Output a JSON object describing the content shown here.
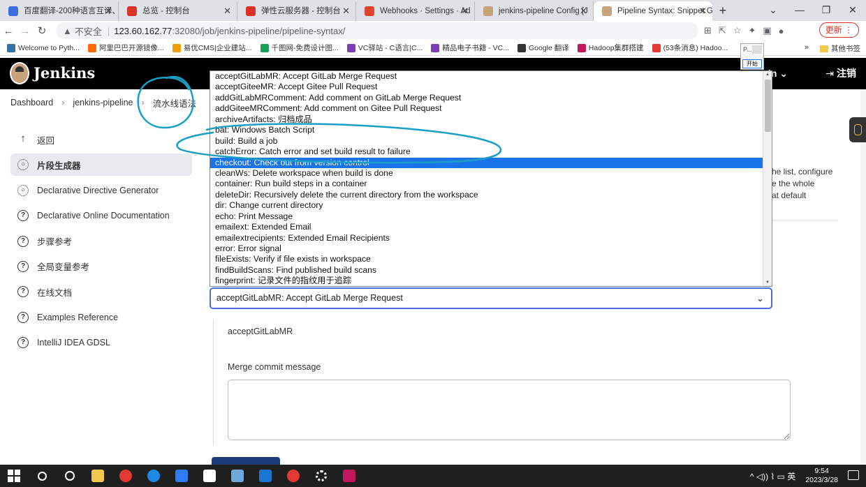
{
  "browser": {
    "tabs": [
      {
        "title": "百度翻译-200种语言互译、",
        "color": "#3b6fe0"
      },
      {
        "title": "总览 - 控制台",
        "color": "#e0302a"
      },
      {
        "title": "弹性云服务器 - 控制台",
        "color": "#e0302a"
      },
      {
        "title": "Webhooks · Settings · Ad",
        "color": "#e2432a"
      },
      {
        "title": "jenkins-pipeline Config [J",
        "color": "#c8a27a"
      },
      {
        "title": "Pipeline Syntax: Snippet G",
        "color": "#c8a27a",
        "active": true
      }
    ],
    "new_tab": "+",
    "window_controls": [
      "⌄",
      "—",
      "❐",
      "✕"
    ],
    "address": {
      "insecure_label": "不安全",
      "host": "123.60.162.77",
      "path": ":32080/job/jenkins-pipeline/pipeline-syntax/"
    },
    "update_button": "更新 ⋮",
    "bookmarks": [
      {
        "label": "Welcome to Pyth...",
        "color": "#3572a5"
      },
      {
        "label": "阿里巴巴开源镜像...",
        "color": "#ff6a00"
      },
      {
        "label": "易优CMS|企业建站...",
        "color": "#f29d0c"
      },
      {
        "label": "千图网-免费设计图...",
        "color": "#19a05a"
      },
      {
        "label": "VC驿站 - C语言|C...",
        "color": "#7a3fb5"
      },
      {
        "label": "精品电子书籍 - VC...",
        "color": "#7a3fb5"
      },
      {
        "label": "Google 翻译",
        "color": "#333333"
      },
      {
        "label": "Hadoop集群搭建",
        "color": "#c2185b"
      },
      {
        "label": "(53条消息) Hadoo...",
        "color": "#e53935"
      }
    ],
    "bookmarks_more": "»",
    "bookmarks_other": "其他书签",
    "mini_popup": {
      "text": "P...",
      "button": "开始"
    }
  },
  "jenkins": {
    "title": "Jenkins",
    "user": "min ⌄",
    "logout": "注销",
    "breadcrumb": [
      "Dashboard",
      "jenkins-pipeline",
      "流水线语法"
    ],
    "sidebar": [
      {
        "label": "返回",
        "icon": "arrow-up-icon"
      },
      {
        "label": "片段生成器",
        "icon": "gear-icon",
        "active": true
      },
      {
        "label": "Declarative Directive Generator",
        "icon": "gear-icon"
      },
      {
        "label": "Declarative Online Documentation",
        "icon": "help-icon"
      },
      {
        "label": "步骤参考",
        "icon": "help-icon"
      },
      {
        "label": "全局变量参考",
        "icon": "help-icon"
      },
      {
        "label": "在线文档",
        "icon": "help-icon"
      },
      {
        "label": "Examples Reference",
        "icon": "help-icon"
      },
      {
        "label": "IntelliJ IDEA GDSL",
        "icon": "help-icon"
      }
    ],
    "desc_fragments": [
      "he list, configure",
      "e the whole",
      "at default"
    ],
    "dropdown": [
      "acceptGitLabMR: Accept GitLab Merge Request",
      "acceptGiteeMR: Accept Gitee Pull Request",
      "addGitLabMRComment: Add comment on GitLab Merge Request",
      "addGiteeMRComment: Add comment on Gitee Pull Request",
      "archiveArtifacts: 归档成品",
      "bat: Windows Batch Script",
      "build: Build a job",
      "catchError: Catch error and set build result to failure",
      "checkout: Check out from version control",
      "cleanWs: Delete workspace when build is done",
      "container: Run build steps in a container",
      "deleteDir: Recursively delete the current directory from the workspace",
      "dir: Change current directory",
      "echo: Print Message",
      "emailext: Extended Email",
      "emailextrecipients: Extended Email Recipients",
      "error: Error signal",
      "fileExists: Verify if file exists in workspace",
      "findBuildScans: Find published build scans",
      "fingerprint: 记录文件的指纹用于追踪"
    ],
    "dropdown_selected_index": 8,
    "select_value": "acceptGitLabMR: Accept GitLab Merge Request",
    "step_name": "acceptGitLabMR",
    "field_label": "Merge commit message",
    "field_value": ""
  },
  "taskbar": {
    "apps": [
      {
        "name": "search-icon",
        "color": "#1f1f1f"
      },
      {
        "name": "task-view-icon",
        "color": "#1f1f1f"
      },
      {
        "name": "file-explorer-icon",
        "color": "#f2c94c"
      },
      {
        "name": "chrome-icon",
        "color": "#e53935"
      },
      {
        "name": "edge-icon",
        "color": "#1e88e5"
      },
      {
        "name": "feishu-icon",
        "color": "#2f7cf6"
      },
      {
        "name": "typora-icon",
        "color": "#ffffff"
      },
      {
        "name": "notepad-icon",
        "color": "#6fa8dc"
      },
      {
        "name": "remote-desktop-icon",
        "color": "#1976d2"
      },
      {
        "name": "unity-icon",
        "color": "#e53935"
      },
      {
        "name": "settings-icon",
        "color": "#1f1f1f"
      },
      {
        "name": "paint-icon",
        "color": "#c2185b"
      }
    ],
    "tray": "^ ◁)) ⌇ ▭ 英",
    "time": "9:54",
    "date": "2023/3/28"
  },
  "annotation_color": "#1a9fc4"
}
